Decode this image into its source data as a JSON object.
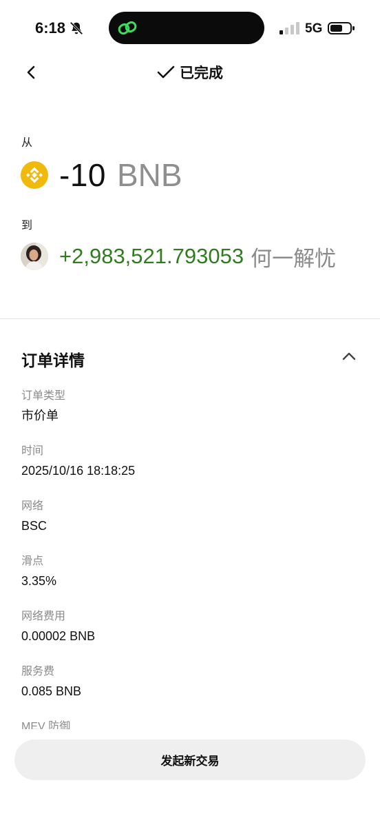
{
  "status_bar": {
    "time": "6:18",
    "network": "5G"
  },
  "header": {
    "status_text": "已完成"
  },
  "transfer": {
    "from_label": "从",
    "from_amount": "-10",
    "from_unit": "BNB",
    "to_label": "到",
    "to_amount": "+2,983,521.793053",
    "to_unit": "何一解忧"
  },
  "order_details": {
    "title": "订单详情",
    "items": [
      {
        "label": "订单类型",
        "value": "市价单"
      },
      {
        "label": "时间",
        "value": "2025/10/16 18:18:25"
      },
      {
        "label": "网络",
        "value": "BSC"
      },
      {
        "label": "滑点",
        "value": "3.35%"
      },
      {
        "label": "网络费用",
        "value": "0.00002 BNB"
      },
      {
        "label": "服务费",
        "value": "0.085 BNB"
      }
    ],
    "partial_label": "MEV 防御"
  },
  "actions": {
    "new_trade_label": "发起新交易"
  },
  "colors": {
    "accent_green": "#2f7d1f",
    "bnb_yellow": "#f0b90b",
    "muted_gray": "#8a8a8a"
  }
}
